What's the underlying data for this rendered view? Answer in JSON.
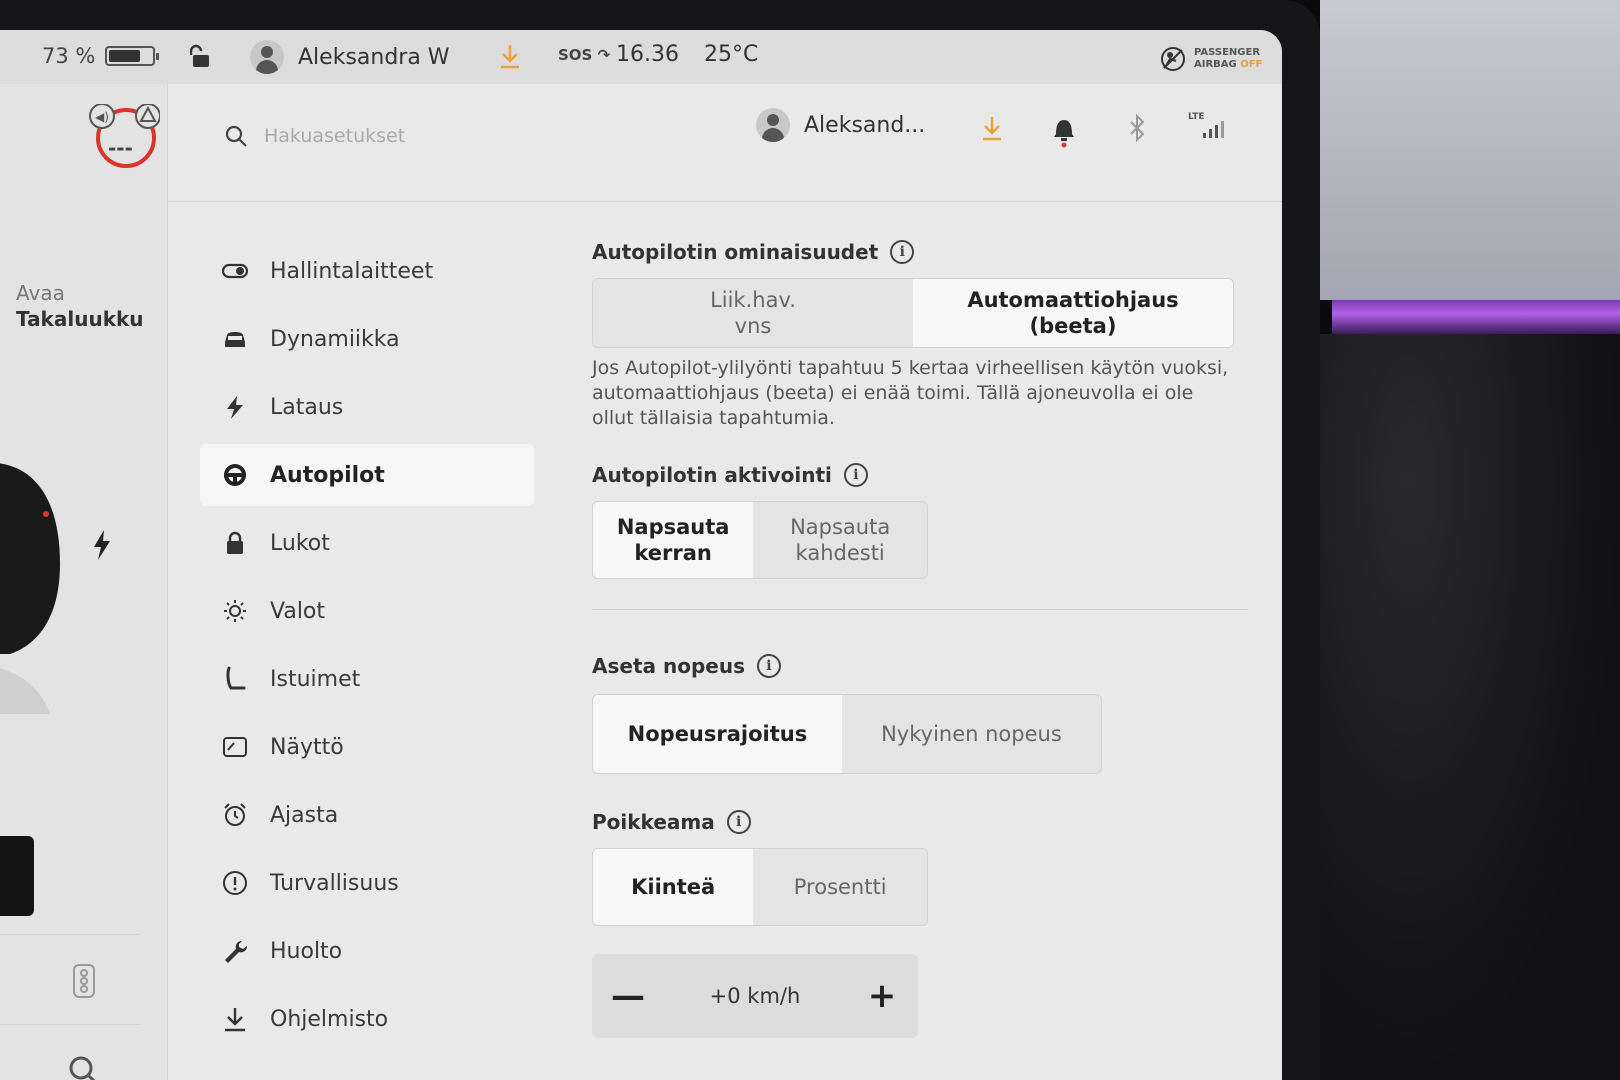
{
  "status": {
    "battery_percent": "73 %",
    "battery_level": 0.73,
    "user_name": "Aleksandra W",
    "sos": "SOS",
    "time": "16.36",
    "temperature": "25°C",
    "airbag_line1": "PASSENGER",
    "airbag_line2": "AIRBAG",
    "airbag_state": "OFF"
  },
  "car_panel": {
    "badge_text": "---",
    "trunk_action": "Avaa",
    "trunk_label": "Takaluukku"
  },
  "header": {
    "search_placeholder": "Hakuasetukset",
    "user_name_short": "Aleksand...",
    "lte_label": "LTE"
  },
  "menu": [
    {
      "label": "Hallintalaitteet",
      "icon": "toggle-icon"
    },
    {
      "label": "Dynamiikka",
      "icon": "car-icon"
    },
    {
      "label": "Lataus",
      "icon": "bolt-icon"
    },
    {
      "label": "Autopilot",
      "icon": "steering-wheel-icon",
      "active": true
    },
    {
      "label": "Lukot",
      "icon": "lock-icon"
    },
    {
      "label": "Valot",
      "icon": "sun-icon"
    },
    {
      "label": "Istuimet",
      "icon": "seat-icon"
    },
    {
      "label": "Näyttö",
      "icon": "display-icon"
    },
    {
      "label": "Ajasta",
      "icon": "alarm-clock-icon"
    },
    {
      "label": "Turvallisuus",
      "icon": "alert-circle-icon"
    },
    {
      "label": "Huolto",
      "icon": "wrench-icon"
    },
    {
      "label": "Ohjelmisto",
      "icon": "download-icon"
    }
  ],
  "autopilot": {
    "features_title": "Autopilotin ominaisuudet",
    "features_options": [
      "Liik.hav.\nvns",
      "Automaattiohjaus\n(beeta)"
    ],
    "features_selected": 1,
    "features_desc": "Jos Autopilot-ylilyönti tapahtuu 5 kertaa virheellisen käytön vuoksi, automaattiohjaus (beeta) ei enää toimi. Tällä ajoneuvolla ei ole ollut tällaisia tapahtumia.",
    "activation_title": "Autopilotin aktivointi",
    "activation_options": [
      "Napsauta kerran",
      "Napsauta\nkahdesti"
    ],
    "activation_selected": 0,
    "speed_title": "Aseta nopeus",
    "speed_options": [
      "Nopeusrajoitus",
      "Nykyinen nopeus"
    ],
    "speed_selected": 0,
    "offset_title": "Poikkeama",
    "offset_options": [
      "Kiinteä",
      "Prosentti"
    ],
    "offset_selected": 0,
    "offset_value": "+0 km/h",
    "minus_label": "—",
    "plus_label": "+"
  },
  "colors": {
    "accent_download": "#e8a33a",
    "badge_red": "#d9352b",
    "bell_dot": "#d9352b",
    "ambient_light": "#a24ed8"
  }
}
